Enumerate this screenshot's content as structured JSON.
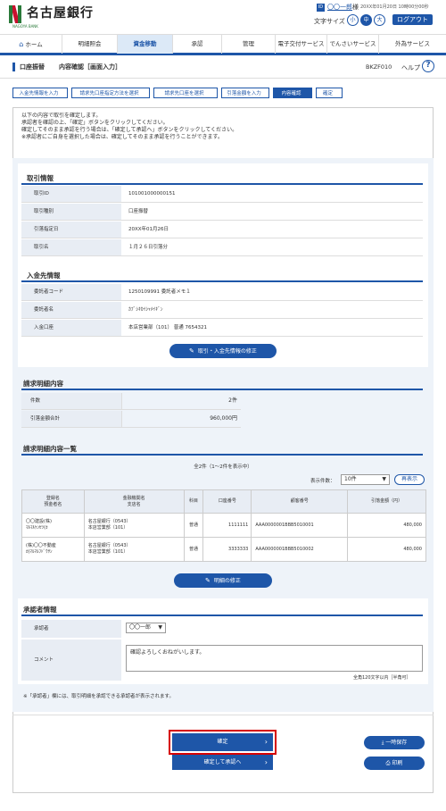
{
  "header": {
    "bank_name": "名古屋銀行",
    "logo_sub": "NAGOYA BANK",
    "user_icon": "ID",
    "user_name": "〇〇一郎",
    "user_suffix": "様",
    "last_login": "20XX年01月20日 10時00分00秒",
    "font_size_label": "文字サイズ",
    "font_sizes": [
      "小",
      "中",
      "大"
    ],
    "logout": "ログアウト"
  },
  "nav": [
    {
      "label": "ホーム"
    },
    {
      "label": "明細照会"
    },
    {
      "label": "資金移動"
    },
    {
      "label": "承認"
    },
    {
      "label": "管理"
    },
    {
      "label": "電子交付サービス"
    },
    {
      "label": "でんさいサービス"
    },
    {
      "label": "外為サービス"
    }
  ],
  "title": {
    "category": "口座振替",
    "name": "内容確認［画面入力］",
    "code": "BKZF010",
    "help": "ヘルプ"
  },
  "steps": [
    "入金先情報を入力",
    "請求先口座指定方法を選択",
    "請求先口座を選択",
    "引落金額を入力",
    "内容確認",
    "確定"
  ],
  "intro": [
    "以下の内容で取引を確定します。",
    "承認者を確認の上、「確定」ボタンをクリックしてください。",
    "確定してそのまま承認を行う場合は、「確定して承認へ」ボタンをクリックしてください。",
    "※承認者にご自身を選択した場合は、確定してそのまま承認を行うことができます。"
  ],
  "transaction": {
    "title": "取引情報",
    "rows": [
      {
        "k": "取引ID",
        "v": "101001000000151"
      },
      {
        "k": "取引種別",
        "v": "口座振替"
      },
      {
        "k": "引落指定日",
        "v": "20XX年01月26日"
      },
      {
        "k": "取引名",
        "v": "１月２６日引落分"
      }
    ]
  },
  "payee": {
    "title": "入金先情報",
    "rows": [
      {
        "k": "委託者コード",
        "v": "1250109991 委託者メモ１"
      },
      {
        "k": "委託者名",
        "v": "ｶﾌﾞｼｷｶｲｼｬﾒｲｷﾞﾝ"
      },
      {
        "k": "入金口座",
        "v": "本店営業部（101） 普通 7654321"
      }
    ],
    "edit_button": "取引・入金先情報の修正"
  },
  "summary": {
    "title": "請求明細内容",
    "rows": [
      {
        "k": "件数",
        "v": "2件"
      },
      {
        "k": "引落金額合計",
        "v": "960,000円"
      }
    ]
  },
  "details": {
    "title": "請求明細内容一覧",
    "count_text": "全2件（1〜2件を表示中）",
    "display_label": "表示件数：",
    "display_value": "10件",
    "redisplay": "再表示",
    "headers": [
      "登録名\n預金者名",
      "金融機関名\n支店名",
      "科目",
      "口座番号",
      "顧客番号",
      "引落金額（円）"
    ],
    "rows": [
      {
        "name": "〇〇建設(株)",
        "kana": "ﾏﾙﾏﾙｹﾝｾﾂ(ｶ",
        "bank": "名古屋銀行（0543）",
        "branch": "本店営業部（101）",
        "type": "普通",
        "acct": "1111111",
        "cust": "AAA0000001BBB5010001",
        "amount": "480,000"
      },
      {
        "name": "(株)〇〇不動産",
        "kana": "ｶ)ﾏﾙﾏﾙﾌﾄﾞｳｻﾝ",
        "bank": "名古屋銀行（0543）",
        "branch": "本店営業部（101）",
        "type": "普通",
        "acct": "3333333",
        "cust": "AAA0000001BBB5010002",
        "amount": "480,000"
      }
    ],
    "edit_button": "明細の修正"
  },
  "approver": {
    "title": "承認者情報",
    "approver_label": "承認者",
    "approver_value": "〇〇一郎",
    "comment_label": "コメント",
    "comment_value": "確認よろしくおねがいします。",
    "comment_limit": "全角120文字以内［半角可］",
    "note": "※「承認者」欄には、取引明細を承認できる承認者が表示されます。"
  },
  "buttons": {
    "confirm": "確定",
    "confirm_approve": "確定して承認へ",
    "temp_save": "一時保存",
    "print": "印刷"
  }
}
